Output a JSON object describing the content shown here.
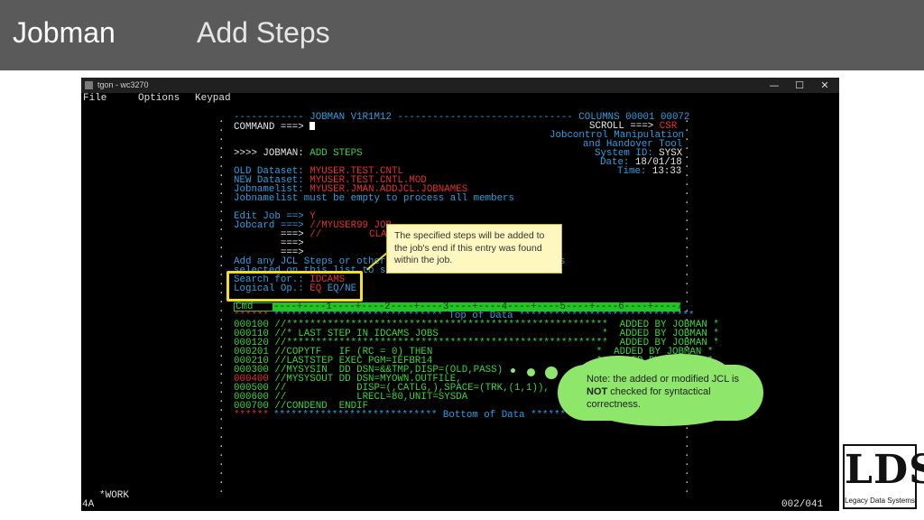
{
  "slide": {
    "title": "Jobman",
    "subtitle": "Add Steps"
  },
  "window": {
    "title": "tgon - wc3270",
    "menu": [
      "File",
      "Options",
      "Keypad"
    ],
    "controls": {
      "minimize": "—",
      "maximize": "☐",
      "close": "✕"
    }
  },
  "screen": {
    "header": "------------ JOBMAN V1R1M12 ------------------------------ COLUMNS 00001 00072",
    "command_label": "COMMAND ===>",
    "scroll": "SCROLL ===>",
    "scroll_value": "CSR",
    "jc1": "Jobcontrol Manipulation",
    "jc2": "and Handover Tool",
    "sysid_label": "System ID: ",
    "sysid_value": "SYSX",
    "date_label": "Date: ",
    "date_value": "18/01/18",
    "time_label": "Time: ",
    "time_value": "13:33",
    "prompt_prefix": ">>>> JOBMAN: ",
    "prompt_action": "ADD STEPS",
    "old_ds_label": "OLD Dataset: ",
    "old_ds_value": "MYUSER.TEST.CNTL",
    "new_ds_label": "NEW Dataset: ",
    "new_ds_value": "MYUSER.TEST.CNTL.MOD",
    "jnl_label": "Jobnamelist: ",
    "jnl_value": "MYUSER.JMAN.ADDJCL.JOBNAMES",
    "jnl_note": "Jobnamelist must be empty to process all members",
    "edit_job_label": "Edit Job ==> ",
    "edit_job_value": "Y",
    "jobcard_label": "Jobcard ===> ",
    "jobcard_value": "//MYUSER99 JOB",
    "jobcard2_label": "        ===> ",
    "jobcard2_value": "//",
    "jobcard2_tail": "CLA",
    "jobcard3": "        ===>",
    "jobcard4": "        ===>",
    "add_any": "Add any JCL Steps or other",
    "add_any_tail": "s",
    "selected": "selected on this list to sele",
    "search_label": "Search for.: ",
    "search_value": "IDCAMS",
    "logical_label": "Logical Op.: ",
    "logical_value": "EQ",
    "logical_options": "EQ/NE",
    "ruler_cmd": "Cmd",
    "ruler": "----+----1----+----2----+----3----+----4----+----5----+----6----+----7--",
    "top_of_data_prefix": "******",
    "top_of_data": "***************************** Top of Data ******************************",
    "lines": [
      {
        "num": "000100",
        "text": "//*******************************************************  ADDED BY JOBMAN *"
      },
      {
        "num": "000110",
        "text": "//* LAST STEP IN IDCAMS JOBS                            *  ADDED BY JOBMAN *"
      },
      {
        "num": "000120",
        "text": "//*******************************************************  ADDED BY JOBMAN *"
      },
      {
        "num": "000201",
        "text": "//COPYTF   IF (RC = 0) THEN                            *  ADDED BY JOBMAN *"
      },
      {
        "num": "000210",
        "text": "//LASTSTEP EXEC PGM=IEFBR14                            *  ADDED BY JOBMAN *"
      },
      {
        "num": "000300",
        "text": "//MYSYSIN  DD DSN=&&TMP,DISP=(OLD,PASS)                *  ADDED BY JOBMAN *"
      },
      {
        "num": "000400",
        "text": "//MYSYSOUT DD DSN=MYOWN.OUTFILE,                       *"
      },
      {
        "num": "000500",
        "text": "//            DISP=(,CATLG,),SPACE=(TRK,(1,1)),"
      },
      {
        "num": "000600",
        "text": "//            LRECL=80,UNIT=SYSDA"
      },
      {
        "num": "000700",
        "text": "//CONDEND  ENDIF"
      }
    ],
    "bottom_prefix": "******",
    "bottom_of_data": "**************************** Bottom of Data ****************************",
    "status_left": "4A",
    "status_work": "*WORK",
    "status_right": "002/041"
  },
  "tooltip": {
    "text": "The specified steps will be added to the job's end if this entry was found within the job."
  },
  "note": {
    "prefix": "Note: the added or modified JCL is ",
    "bold": "NOT",
    "suffix": " checked for syntactical correctness."
  },
  "logo": {
    "big": "LDS",
    "small": "Legacy Data Systems"
  },
  "colors": {
    "green": "#3cd23c",
    "turquoise": "#2a9fe0",
    "red": "#e23030",
    "yellow": "#f2e020",
    "cloud": "#8ee66a"
  }
}
